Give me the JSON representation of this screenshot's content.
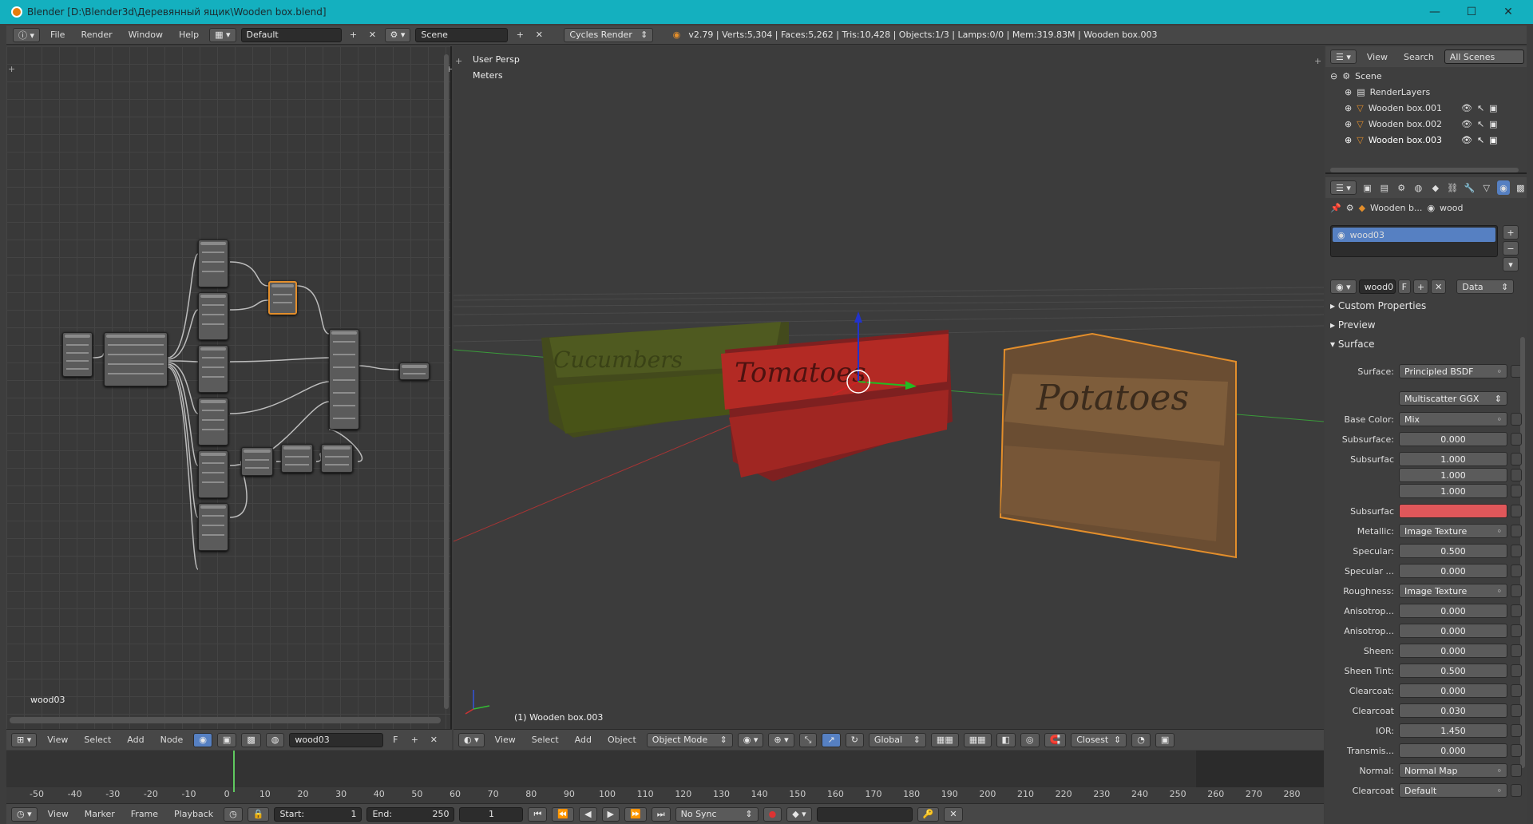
{
  "window": {
    "title": "Blender [D:\\Blender3d\\Деревянный ящик\\Wooden box.blend]",
    "minimize": "—",
    "maximize": "☐",
    "close": "✕"
  },
  "topbar": {
    "menus": [
      "File",
      "Render",
      "Window",
      "Help"
    ],
    "layout": "Default",
    "scene": "Scene",
    "engine": "Cycles Render",
    "stats": "v2.79 | Verts:5,304 | Faces:5,262 | Tris:10,428 | Objects:1/3 | Lamps:0/0 | Mem:319.83M | Wooden box.003"
  },
  "node_editor": {
    "material_label": "wood03",
    "header_menus": [
      "View",
      "Select",
      "Add",
      "Node"
    ],
    "material_field": "wood03",
    "fake_user": "F"
  },
  "viewport": {
    "view_name": "User Persp",
    "units": "Meters",
    "object_label": "(1) Wooden box.003",
    "header_menus": [
      "View",
      "Select",
      "Add",
      "Object"
    ],
    "mode": "Object Mode",
    "orientation": "Global",
    "snap": "Closest",
    "crate_texts": [
      "Cucumbers",
      "Tomatoes",
      "Potatoes"
    ]
  },
  "outliner": {
    "header_menus": [
      "View",
      "Search"
    ],
    "filter": "All Scenes",
    "items": [
      {
        "label": "Scene",
        "icon": "scene-icon"
      },
      {
        "label": "RenderLayers",
        "icon": "renderlayers-icon"
      },
      {
        "label": "Wooden box.001",
        "icon": "mesh-icon"
      },
      {
        "label": "Wooden box.002",
        "icon": "mesh-icon"
      },
      {
        "label": "Wooden box.003",
        "icon": "mesh-icon"
      }
    ]
  },
  "properties": {
    "breadcrumb_object": "Wooden b...",
    "breadcrumb_material": "wood",
    "material_slot": "wood03",
    "material_field": "wood0",
    "fake_user": "F",
    "link": "Data",
    "panels": [
      "Custom Properties",
      "Preview",
      "Surface"
    ],
    "surface_label": "Surface:",
    "surface_value": "Principled BSDF",
    "distribution": "Multiscatter GGX",
    "rows": [
      {
        "label": "Base Color:",
        "value": "Mix",
        "kind": "select"
      },
      {
        "label": "Subsurface:",
        "value": "0.000",
        "kind": "num"
      },
      {
        "label": "Subsurfac",
        "value": "1.000",
        "kind": "num"
      },
      {
        "label": "",
        "value": "1.000",
        "kind": "num"
      },
      {
        "label": "",
        "value": "1.000",
        "kind": "num"
      },
      {
        "label": "Subsurfac",
        "value": "",
        "kind": "color"
      },
      {
        "label": "Metallic:",
        "value": "Image Texture",
        "kind": "select"
      },
      {
        "label": "Specular:",
        "value": "0.500",
        "kind": "num"
      },
      {
        "label": "Specular ...",
        "value": "0.000",
        "kind": "num"
      },
      {
        "label": "Roughness:",
        "value": "Image Texture",
        "kind": "select"
      },
      {
        "label": "Anisotrop...",
        "value": "0.000",
        "kind": "num"
      },
      {
        "label": "Anisotrop...",
        "value": "0.000",
        "kind": "num"
      },
      {
        "label": "Sheen:",
        "value": "0.000",
        "kind": "num"
      },
      {
        "label": "Sheen Tint:",
        "value": "0.500",
        "kind": "num"
      },
      {
        "label": "Clearcoat:",
        "value": "0.000",
        "kind": "num"
      },
      {
        "label": "Clearcoat",
        "value": "0.030",
        "kind": "num"
      },
      {
        "label": "IOR:",
        "value": "1.450",
        "kind": "num"
      },
      {
        "label": "Transmis...",
        "value": "0.000",
        "kind": "num"
      },
      {
        "label": "Normal:",
        "value": "Normal Map",
        "kind": "select"
      },
      {
        "label": "Clearcoat",
        "value": "Default",
        "kind": "select"
      }
    ],
    "subsurface_color": "#e0575a"
  },
  "timeline": {
    "ticks": [
      "-50",
      "-40",
      "-30",
      "-20",
      "-10",
      "0",
      "10",
      "20",
      "30",
      "40",
      "50",
      "60",
      "70",
      "80",
      "90",
      "100",
      "110",
      "120",
      "130",
      "140",
      "150",
      "160",
      "170",
      "180",
      "190",
      "200",
      "210",
      "220",
      "230",
      "240",
      "250",
      "260",
      "270",
      "280"
    ],
    "header_menus": [
      "View",
      "Marker",
      "Frame",
      "Playback"
    ],
    "start": "Start:",
    "start_val": "1",
    "end": "End:",
    "end_val": "250",
    "current": "1",
    "sync": "No Sync"
  },
  "colors": {
    "accent": "#e38e2b",
    "selection": "#5680c2",
    "title": "#14b0bf"
  }
}
